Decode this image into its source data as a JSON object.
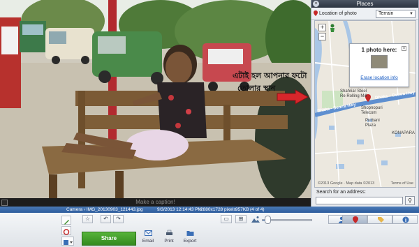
{
  "photo": {
    "overlay_line1": "এটাই হল আপনার ফটো",
    "overlay_line2": "তোলার স্থান",
    "caption_placeholder": "Make a caption!"
  },
  "places": {
    "title": "Places",
    "close_icon": "close-icon",
    "location_label": "Location of photo",
    "map_type": "Terrain",
    "popup_title": "1 photo here:",
    "erase_link": "Erase location info",
    "labels": {
      "steel": "Shahriar Steel\nRe Rolling Mill",
      "road": "Dhaka - Demra Hwy",
      "road2": "Dhaka – Demra Hwy",
      "shopnopuri": "Shopnopuri\nTelecom",
      "purbani": "Purbani\nPlaza",
      "konapara": "KONAPARA"
    },
    "copyright": "©2013 Google",
    "map_data": "Map data ©2013",
    "terms": "Terms of Use",
    "search_label": "Search for an address:",
    "search_value": ""
  },
  "status": {
    "path": "Camera › IMG_20130903_121443.jpg",
    "datetime": "9/3/2013 12:14:43 PM",
    "size": "2880x1728 pixels",
    "filesize": "957KB",
    "position": "(4 of 4)"
  },
  "toolbar": {
    "share_label": "Share",
    "email_label": "Email",
    "print_label": "Print",
    "export_label": "Export",
    "zoom_level": 0.12
  },
  "colors": {
    "status_bar": "#3a6aab",
    "share_green": "#449f2c",
    "map_road": "#5e8fd0"
  }
}
